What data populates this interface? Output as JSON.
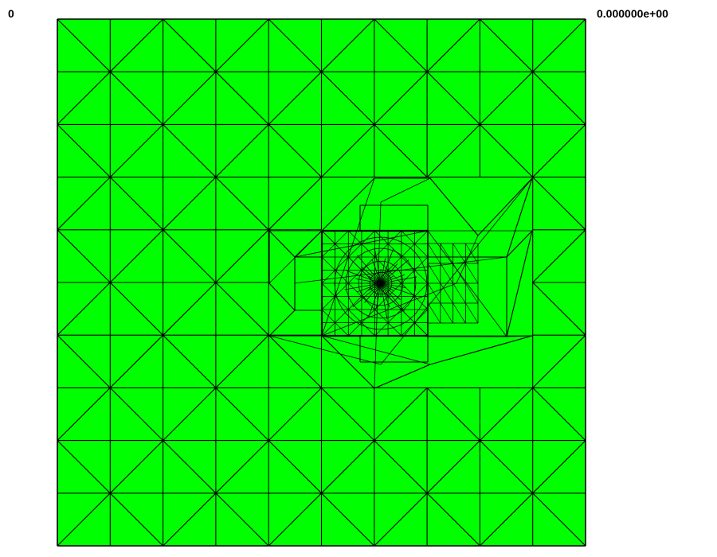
{
  "labels": {
    "step": "0",
    "value": "0.000000e+00"
  },
  "mesh": {
    "fill_color": "#00ff00",
    "edge_color": "#000000",
    "grid_cells": 10
  }
}
